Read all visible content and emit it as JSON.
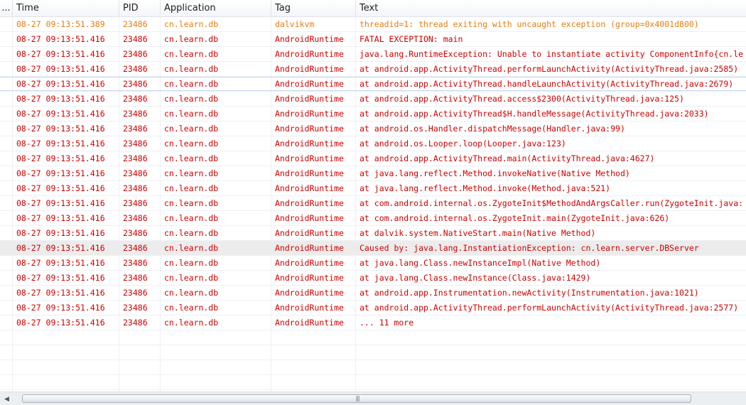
{
  "columns": {
    "dots": "...",
    "time": "Time",
    "pid": "PID",
    "application": "Application",
    "tag": "Tag",
    "text": "Text"
  },
  "level_colors": {
    "warn": "#e67e11",
    "error": "#d00000"
  },
  "rows": [
    {
      "level": "warn",
      "time": "08-27 09:13:51.389",
      "pid": "23486",
      "app": "cn.learn.db",
      "tag": "dalvikvm",
      "text": "threadid=1: thread exiting with uncaught exception (group=0x4001d800)"
    },
    {
      "level": "error",
      "time": "08-27 09:13:51.416",
      "pid": "23486",
      "app": "cn.learn.db",
      "tag": "AndroidRuntime",
      "text": "FATAL EXCEPTION: main"
    },
    {
      "level": "error",
      "time": "08-27 09:13:51.416",
      "pid": "23486",
      "app": "cn.learn.db",
      "tag": "AndroidRuntime",
      "text": "java.lang.RuntimeException: Unable to instantiate activity ComponentInfo{cn.le"
    },
    {
      "level": "error",
      "time": "08-27 09:13:51.416",
      "pid": "23486",
      "app": "cn.learn.db",
      "tag": "AndroidRuntime",
      "text": "at android.app.ActivityThread.performLaunchActivity(ActivityThread.java:2585)"
    },
    {
      "level": "error",
      "time": "08-27 09:13:51.416",
      "pid": "23486",
      "app": "cn.learn.db",
      "tag": "AndroidRuntime",
      "text": "at android.app.ActivityThread.handleLaunchActivity(ActivityThread.java:2679)"
    },
    {
      "level": "error",
      "time": "08-27 09:13:51.416",
      "pid": "23486",
      "app": "cn.learn.db",
      "tag": "AndroidRuntime",
      "text": "at android.app.ActivityThread.access$2300(ActivityThread.java:125)"
    },
    {
      "level": "error",
      "time": "08-27 09:13:51.416",
      "pid": "23486",
      "app": "cn.learn.db",
      "tag": "AndroidRuntime",
      "text": "at android.app.ActivityThread$H.handleMessage(ActivityThread.java:2033)"
    },
    {
      "level": "error",
      "time": "08-27 09:13:51.416",
      "pid": "23486",
      "app": "cn.learn.db",
      "tag": "AndroidRuntime",
      "text": "at android.os.Handler.dispatchMessage(Handler.java:99)"
    },
    {
      "level": "error",
      "time": "08-27 09:13:51.416",
      "pid": "23486",
      "app": "cn.learn.db",
      "tag": "AndroidRuntime",
      "text": "at android.os.Looper.loop(Looper.java:123)"
    },
    {
      "level": "error",
      "time": "08-27 09:13:51.416",
      "pid": "23486",
      "app": "cn.learn.db",
      "tag": "AndroidRuntime",
      "text": "at android.app.ActivityThread.main(ActivityThread.java:4627)"
    },
    {
      "level": "error",
      "time": "08-27 09:13:51.416",
      "pid": "23486",
      "app": "cn.learn.db",
      "tag": "AndroidRuntime",
      "text": "at java.lang.reflect.Method.invokeNative(Native Method)"
    },
    {
      "level": "error",
      "time": "08-27 09:13:51.416",
      "pid": "23486",
      "app": "cn.learn.db",
      "tag": "AndroidRuntime",
      "text": "at java.lang.reflect.Method.invoke(Method.java:521)"
    },
    {
      "level": "error",
      "time": "08-27 09:13:51.416",
      "pid": "23486",
      "app": "cn.learn.db",
      "tag": "AndroidRuntime",
      "text": "at com.android.internal.os.ZygoteInit$MethodAndArgsCaller.run(ZygoteInit.java:"
    },
    {
      "level": "error",
      "time": "08-27 09:13:51.416",
      "pid": "23486",
      "app": "cn.learn.db",
      "tag": "AndroidRuntime",
      "text": "at com.android.internal.os.ZygoteInit.main(ZygoteInit.java:626)"
    },
    {
      "level": "error",
      "time": "08-27 09:13:51.416",
      "pid": "23486",
      "app": "cn.learn.db",
      "tag": "AndroidRuntime",
      "text": "at dalvik.system.NativeStart.main(Native Method)"
    },
    {
      "level": "error",
      "time": "08-27 09:13:51.416",
      "pid": "23486",
      "app": "cn.learn.db",
      "tag": "AndroidRuntime",
      "text": "Caused by: java.lang.InstantiationException: cn.learn.server.DBServer"
    },
    {
      "level": "error",
      "time": "08-27 09:13:51.416",
      "pid": "23486",
      "app": "cn.learn.db",
      "tag": "AndroidRuntime",
      "text": "at java.lang.Class.newInstanceImpl(Native Method)"
    },
    {
      "level": "error",
      "time": "08-27 09:13:51.416",
      "pid": "23486",
      "app": "cn.learn.db",
      "tag": "AndroidRuntime",
      "text": "at java.lang.Class.newInstance(Class.java:1429)"
    },
    {
      "level": "error",
      "time": "08-27 09:13:51.416",
      "pid": "23486",
      "app": "cn.learn.db",
      "tag": "AndroidRuntime",
      "text": "at android.app.Instrumentation.newActivity(Instrumentation.java:1021)"
    },
    {
      "level": "error",
      "time": "08-27 09:13:51.416",
      "pid": "23486",
      "app": "cn.learn.db",
      "tag": "AndroidRuntime",
      "text": "at android.app.ActivityThread.performLaunchActivity(ActivityThread.java:2577)"
    },
    {
      "level": "error",
      "time": "08-27 09:13:51.416",
      "pid": "23486",
      "app": "cn.learn.db",
      "tag": "AndroidRuntime",
      "text": "... 11 more"
    }
  ],
  "scrollbar": {
    "left_arrow": "◀",
    "grip": "|||"
  }
}
